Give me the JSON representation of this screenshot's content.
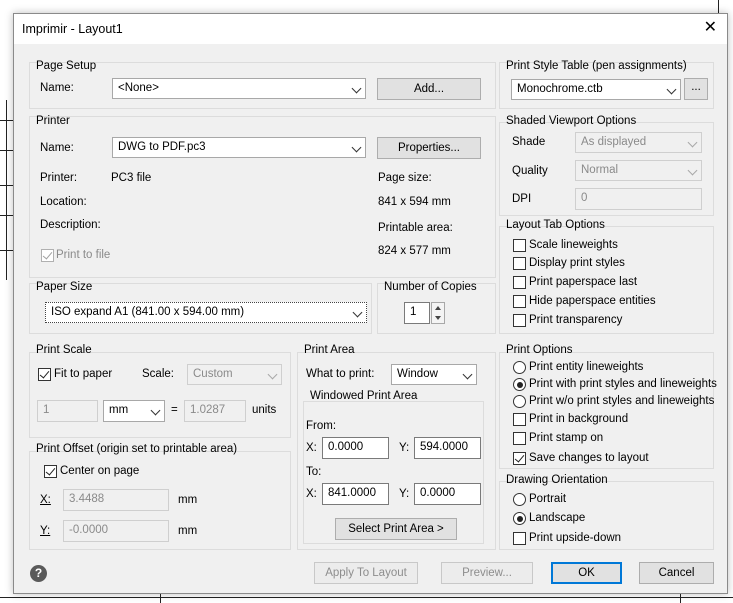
{
  "window": {
    "title": "Imprimir - Layout1",
    "close_glyph": "✕"
  },
  "page_setup": {
    "legend": "Page Setup",
    "name_label": "Name:",
    "name_value": "<None>",
    "add_button": "Add..."
  },
  "printer": {
    "legend": "Printer",
    "name_label": "Name:",
    "name_value": "DWG to PDF.pc3",
    "properties_button": "Properties...",
    "printer_label": "Printer:",
    "printer_value": "PC3 file",
    "location_label": "Location:",
    "description_label": "Description:",
    "print_to_file_label": "Print to file",
    "page_size_label": "Page size:",
    "page_size_value": "841 x 594 mm",
    "printable_area_label": "Printable area:",
    "printable_area_value": "824 x 577 mm"
  },
  "paper_size": {
    "legend": "Paper Size",
    "value": "ISO expand A1 (841.00 x 594.00 mm)"
  },
  "copies": {
    "legend": "Number of Copies",
    "value": "1"
  },
  "print_scale": {
    "legend": "Print Scale",
    "fit_to_paper": "Fit to paper",
    "scale_label": "Scale:",
    "scale_value": "Custom",
    "value_1": "1",
    "unit_select": "mm",
    "equals": "=",
    "value_2": "1.0287",
    "units_label": "units"
  },
  "print_offset": {
    "legend": "Print Offset (origin set to printable area)",
    "center_on_page": "Center on page",
    "x_label": "X:",
    "x_value": "3.4488",
    "x_unit": "mm",
    "y_label": "Y:",
    "y_value": "-0.0000",
    "y_unit": "mm"
  },
  "print_area": {
    "legend": "Print Area",
    "what_label": "What to print:",
    "what_value": "Window",
    "windowed_legend": "Windowed Print Area",
    "from_label": "From:",
    "from_x_label": "X:",
    "from_x": "0.0000",
    "from_y_label": "Y:",
    "from_y": "594.0000",
    "to_label": "To:",
    "to_x_label": "X:",
    "to_x": "841.0000",
    "to_y_label": "Y:",
    "to_y": "0.0000",
    "select_button": "Select Print Area >"
  },
  "style_table": {
    "legend": "Print Style Table (pen assignments)",
    "value": "Monochrome.ctb",
    "edit_button": "..."
  },
  "shaded_viewport": {
    "legend": "Shaded Viewport Options",
    "shade_label": "Shade",
    "shade_value": "As displayed",
    "quality_label": "Quality",
    "quality_value": "Normal",
    "dpi_label": "DPI",
    "dpi_value": "0"
  },
  "layout_tab": {
    "legend": "Layout Tab Options",
    "items": [
      {
        "label": "Scale lineweights",
        "checked": false
      },
      {
        "label": "Display print styles",
        "checked": false
      },
      {
        "label": "Print paperspace last",
        "checked": false
      },
      {
        "label": "Hide paperspace entities",
        "checked": false
      },
      {
        "label": "Print transparency",
        "checked": false
      }
    ]
  },
  "print_options": {
    "legend": "Print Options",
    "radios": [
      {
        "label": "Print entity lineweights",
        "selected": false
      },
      {
        "label": "Print with print styles and lineweights",
        "selected": true
      },
      {
        "label": "Print w/o print styles and lineweights",
        "selected": false
      }
    ],
    "checks": [
      {
        "label": "Print in background",
        "checked": false
      },
      {
        "label": "Print stamp on",
        "checked": false
      },
      {
        "label": "Save changes to layout",
        "checked": true
      }
    ]
  },
  "drawing_orientation": {
    "legend": "Drawing Orientation",
    "portrait": "Portrait",
    "landscape": "Landscape",
    "upside_down": "Print upside-down"
  },
  "footer": {
    "help_glyph": "?",
    "apply_button": "Apply To Layout",
    "preview_button": "Preview...",
    "ok_button": "OK",
    "cancel_button": "Cancel"
  }
}
